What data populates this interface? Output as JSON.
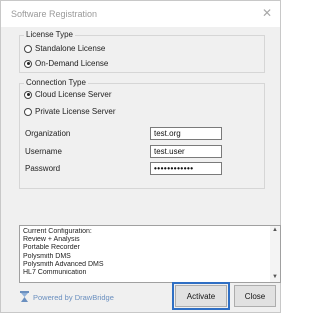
{
  "window": {
    "title": "Software Registration",
    "close_glyph": "✕"
  },
  "license_type": {
    "label": "License Type",
    "options": [
      {
        "label": "Standalone License",
        "checked": false
      },
      {
        "label": "On-Demand License",
        "checked": true
      }
    ]
  },
  "connection_type": {
    "label": "Connection Type",
    "options": [
      {
        "label": "Cloud License Server",
        "checked": true
      },
      {
        "label": "Private License Server",
        "checked": false
      }
    ],
    "fields": {
      "organization": {
        "label": "Organization",
        "value": "test.org"
      },
      "username": {
        "label": "Username",
        "value": "test.user"
      },
      "password": {
        "label": "Password",
        "value": "••••••••••••"
      }
    }
  },
  "configuration": {
    "lines": [
      "Current Configuration:",
      "Review + Analysis",
      "Portable Recorder",
      "Polysmith DMS",
      "Polysmith Advanced DMS",
      "HL7 Communication"
    ],
    "scroll_up_glyph": "▲",
    "scroll_down_glyph": "▼"
  },
  "footer": {
    "powered_by": "Powered by DrawBridge",
    "activate_label": "Activate",
    "close_label": "Close"
  },
  "colors": {
    "accent": "#2f6fc4",
    "link": "#6a8fbf"
  }
}
